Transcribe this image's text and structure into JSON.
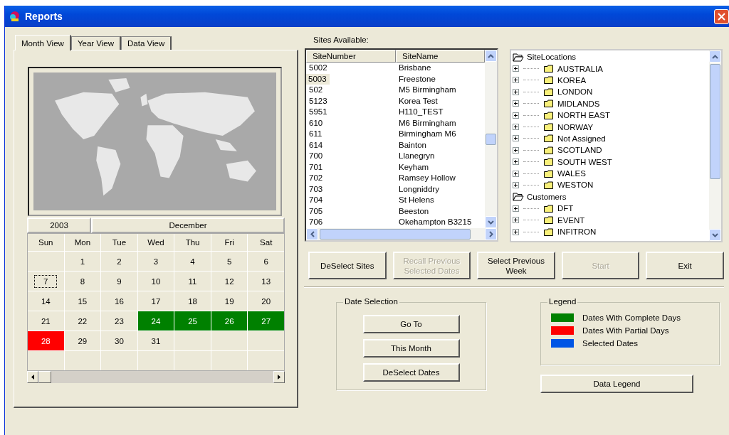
{
  "window": {
    "title": "Reports"
  },
  "tabs": [
    {
      "label": "Month View",
      "selected": true
    },
    {
      "label": "Year View",
      "selected": false
    },
    {
      "label": "Data View",
      "selected": false
    }
  ],
  "calendar": {
    "year": "2003",
    "month": "December",
    "weekdays": [
      "Sun",
      "Mon",
      "Tue",
      "Wed",
      "Thu",
      "Fri",
      "Sat"
    ],
    "weeks": [
      [
        {
          "kind": "blank"
        },
        {
          "kind": "day",
          "day": "1",
          "focused": false
        },
        {
          "kind": "day",
          "day": "2",
          "focused": false
        },
        {
          "kind": "day",
          "day": "3",
          "focused": false
        },
        {
          "kind": "day",
          "day": "4",
          "focused": false
        },
        {
          "kind": "day",
          "day": "5",
          "focused": false
        },
        {
          "kind": "day",
          "day": "6",
          "focused": false
        }
      ],
      [
        {
          "kind": "day",
          "day": "7",
          "focused": true
        },
        {
          "kind": "day",
          "day": "8",
          "focused": false
        },
        {
          "kind": "day",
          "day": "9",
          "focused": false
        },
        {
          "kind": "day",
          "day": "10",
          "focused": false
        },
        {
          "kind": "day",
          "day": "11",
          "focused": false
        },
        {
          "kind": "day",
          "day": "12",
          "focused": false
        },
        {
          "kind": "day",
          "day": "13",
          "focused": false
        }
      ],
      [
        {
          "kind": "day",
          "day": "14",
          "focused": false
        },
        {
          "kind": "day",
          "day": "15",
          "focused": false
        },
        {
          "kind": "day",
          "day": "16",
          "focused": false
        },
        {
          "kind": "day",
          "day": "17",
          "focused": false
        },
        {
          "kind": "day",
          "day": "18",
          "focused": false
        },
        {
          "kind": "day",
          "day": "19",
          "focused": false
        },
        {
          "kind": "day",
          "day": "20",
          "focused": false
        }
      ],
      [
        {
          "kind": "day",
          "day": "21",
          "focused": false
        },
        {
          "kind": "day",
          "day": "22",
          "focused": false
        },
        {
          "kind": "day",
          "day": "23",
          "focused": false
        },
        {
          "kind": "day",
          "day": "24",
          "focused": false,
          "color": "#008000"
        },
        {
          "kind": "day",
          "day": "25",
          "focused": false,
          "color": "#008000"
        },
        {
          "kind": "day",
          "day": "26",
          "focused": false,
          "color": "#008000"
        },
        {
          "kind": "day",
          "day": "27",
          "focused": false,
          "color": "#008000"
        }
      ],
      [
        {
          "kind": "day",
          "day": "28",
          "focused": false,
          "color": "#ff0000"
        },
        {
          "kind": "day",
          "day": "29",
          "focused": false
        },
        {
          "kind": "day",
          "day": "30",
          "focused": false
        },
        {
          "kind": "day",
          "day": "31",
          "focused": false
        },
        {
          "kind": "blank"
        },
        {
          "kind": "blank"
        },
        {
          "kind": "blank"
        }
      ],
      [
        {
          "kind": "blank"
        },
        {
          "kind": "blank"
        },
        {
          "kind": "blank"
        },
        {
          "kind": "blank"
        },
        {
          "kind": "blank"
        },
        {
          "kind": "blank"
        },
        {
          "kind": "blank"
        }
      ]
    ]
  },
  "sites": {
    "label": "Sites Available:",
    "columns": [
      "SiteNumber",
      "SiteName"
    ],
    "rows": [
      {
        "number": "5002",
        "name": "Brisbane",
        "selected": false
      },
      {
        "number": "5003",
        "name": "Freestone",
        "selected": true
      },
      {
        "number": "502",
        "name": "M5 Birmingham",
        "selected": false
      },
      {
        "number": "5123",
        "name": "Korea Test",
        "selected": false
      },
      {
        "number": "5951",
        "name": "H110_TEST",
        "selected": false
      },
      {
        "number": "610",
        "name": "M6 Birmingham",
        "selected": false
      },
      {
        "number": "611",
        "name": "Birmingham M6",
        "selected": false
      },
      {
        "number": "614",
        "name": "Bainton",
        "selected": false
      },
      {
        "number": "700",
        "name": "Llanegryn",
        "selected": false
      },
      {
        "number": "701",
        "name": "Keyham",
        "selected": false
      },
      {
        "number": "702",
        "name": "Ramsey Hollow",
        "selected": false
      },
      {
        "number": "703",
        "name": "Longniddry",
        "selected": false
      },
      {
        "number": "704",
        "name": "St Helens",
        "selected": false
      },
      {
        "number": "705",
        "name": "Beeston",
        "selected": false
      },
      {
        "number": "706",
        "name": "Okehampton B3215",
        "selected": false
      }
    ]
  },
  "tree": [
    {
      "label": "SiteLocations",
      "expanded": true,
      "children": [
        {
          "label": "AUSTRALIA",
          "expanded": false
        },
        {
          "label": "KOREA",
          "expanded": false
        },
        {
          "label": "LONDON",
          "expanded": false
        },
        {
          "label": "MIDLANDS",
          "expanded": false
        },
        {
          "label": "NORTH EAST",
          "expanded": false
        },
        {
          "label": "NORWAY",
          "expanded": false
        },
        {
          "label": "Not Assigned",
          "expanded": false
        },
        {
          "label": "SCOTLAND",
          "expanded": false
        },
        {
          "label": "SOUTH WEST",
          "expanded": false
        },
        {
          "label": "WALES",
          "expanded": false
        },
        {
          "label": "WESTON",
          "expanded": false
        }
      ]
    },
    {
      "label": "Customers",
      "expanded": true,
      "children": [
        {
          "label": "DFT",
          "expanded": false
        },
        {
          "label": "EVENT",
          "expanded": false
        },
        {
          "label": "INFITRON",
          "expanded": false
        }
      ]
    }
  ],
  "actions": [
    {
      "label": "DeSelect Sites",
      "disabled": false
    },
    {
      "label": "Recall Previous Selected Dates",
      "disabled": true
    },
    {
      "label": "Select Previous Week",
      "disabled": false
    },
    {
      "label": "Start",
      "disabled": true
    },
    {
      "label": "Exit",
      "disabled": false
    }
  ],
  "date_selection": {
    "title": "Date Selection",
    "buttons": [
      "Go To",
      "This Month",
      "DeSelect Dates"
    ]
  },
  "legend": {
    "title": "Legend",
    "items": [
      {
        "label": "Dates With Complete Days",
        "color": "#008000"
      },
      {
        "label": "Dates With Partial Days",
        "color": "#ff0000"
      },
      {
        "label": "Selected Dates",
        "color": "#0055e5"
      }
    ]
  },
  "data_legend_button": "Data Legend"
}
